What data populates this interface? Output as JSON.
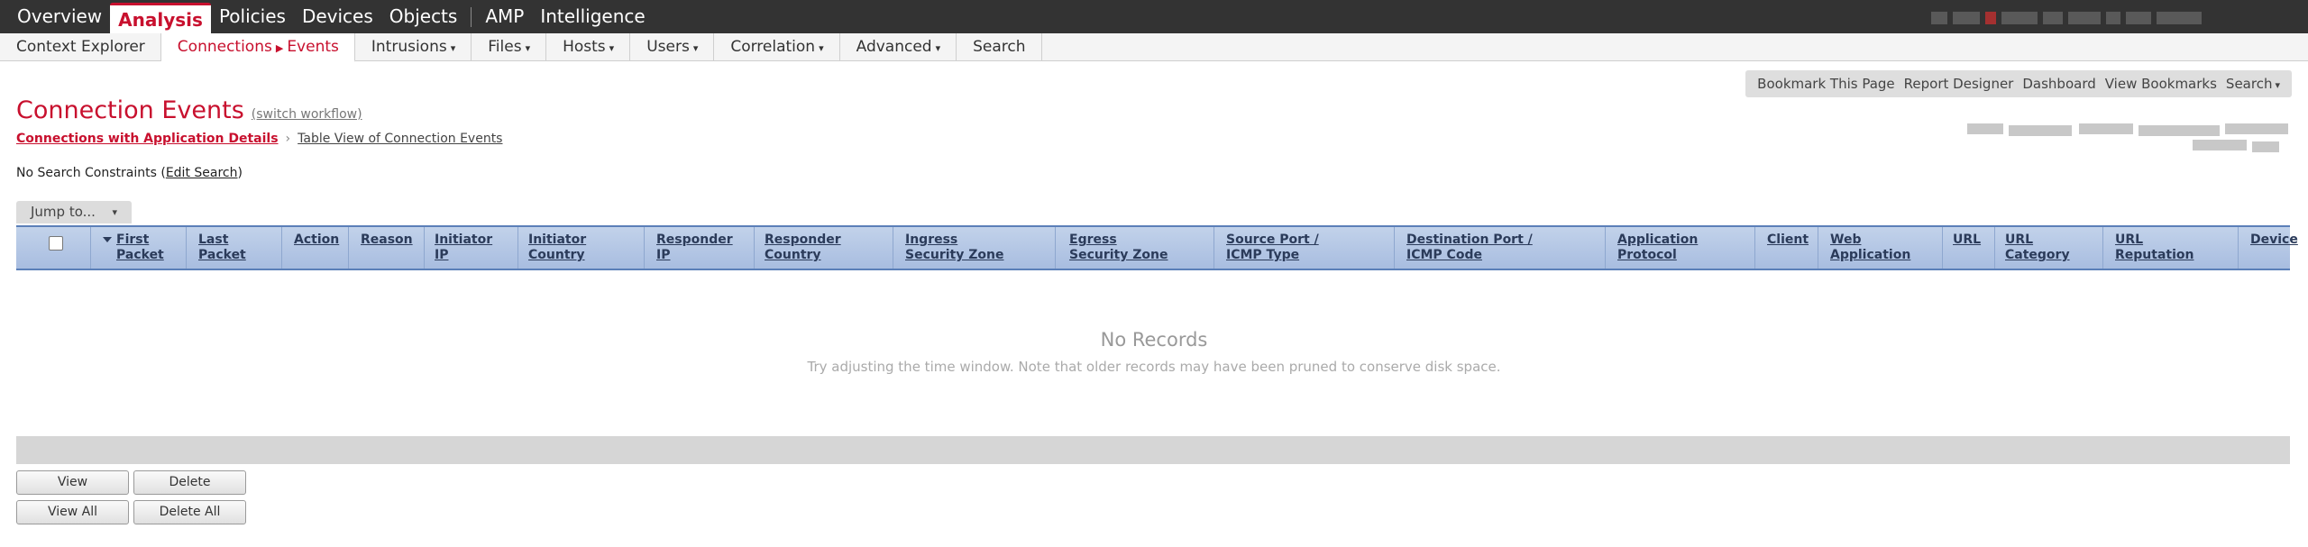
{
  "topnav": {
    "items": [
      "Overview",
      "Analysis",
      "Policies",
      "Devices",
      "Objects",
      "AMP",
      "Intelligence"
    ]
  },
  "subnav": {
    "context_explorer": "Context Explorer",
    "connections": "Connections",
    "events": "Events",
    "intrusions": "Intrusions",
    "files": "Files",
    "hosts": "Hosts",
    "users": "Users",
    "correlation": "Correlation",
    "advanced": "Advanced",
    "search": "Search",
    "caret": "▾"
  },
  "toolbar": {
    "bookmark": "Bookmark This Page",
    "report_designer": "Report Designer",
    "dashboard": "Dashboard",
    "view_bookmarks": "View Bookmarks",
    "search": "Search"
  },
  "page": {
    "title": "Connection Events",
    "switch_workflow": "(switch workflow)",
    "crumb_active": "Connections with Application Details",
    "crumb_next": "Table View of Connection Events",
    "constraints_prefix": "No Search Constraints (",
    "edit_search": "Edit Search",
    "constraints_suffix": ")",
    "jump_to": "Jump to..."
  },
  "table": {
    "columns": [
      {
        "line1": "First",
        "line2": "Packet"
      },
      {
        "line1": "Last",
        "line2": "Packet"
      },
      {
        "line1": "Action",
        "line2": ""
      },
      {
        "line1": "Reason",
        "line2": ""
      },
      {
        "line1": "Initiator",
        "line2": "IP"
      },
      {
        "line1": "Initiator",
        "line2": "Country"
      },
      {
        "line1": "Responder",
        "line2": "IP"
      },
      {
        "line1": "Responder",
        "line2": "Country"
      },
      {
        "line1": "Ingress",
        "line2": "Security Zone"
      },
      {
        "line1": "Egress",
        "line2": "Security Zone"
      },
      {
        "line1": "Source Port /",
        "line2": "ICMP Type"
      },
      {
        "line1": "Destination Port /",
        "line2": "ICMP Code"
      },
      {
        "line1": "Application",
        "line2": "Protocol"
      },
      {
        "line1": "Client",
        "line2": ""
      },
      {
        "line1": "Web",
        "line2": "Application"
      },
      {
        "line1": "URL",
        "line2": ""
      },
      {
        "line1": "URL",
        "line2": "Category"
      },
      {
        "line1": "URL",
        "line2": "Reputation"
      },
      {
        "line1": "Device",
        "line2": ""
      }
    ],
    "no_records": "No Records",
    "no_records_hint": "Try adjusting the time window. Note that older records may have been pruned to conserve disk space."
  },
  "buttons": {
    "view": "View",
    "delete": "Delete",
    "view_all": "View All",
    "delete_all": "Delete All"
  },
  "colors": {
    "accent": "#c8102e",
    "topbar": "#333333",
    "table_header": "#b5c7e6"
  }
}
